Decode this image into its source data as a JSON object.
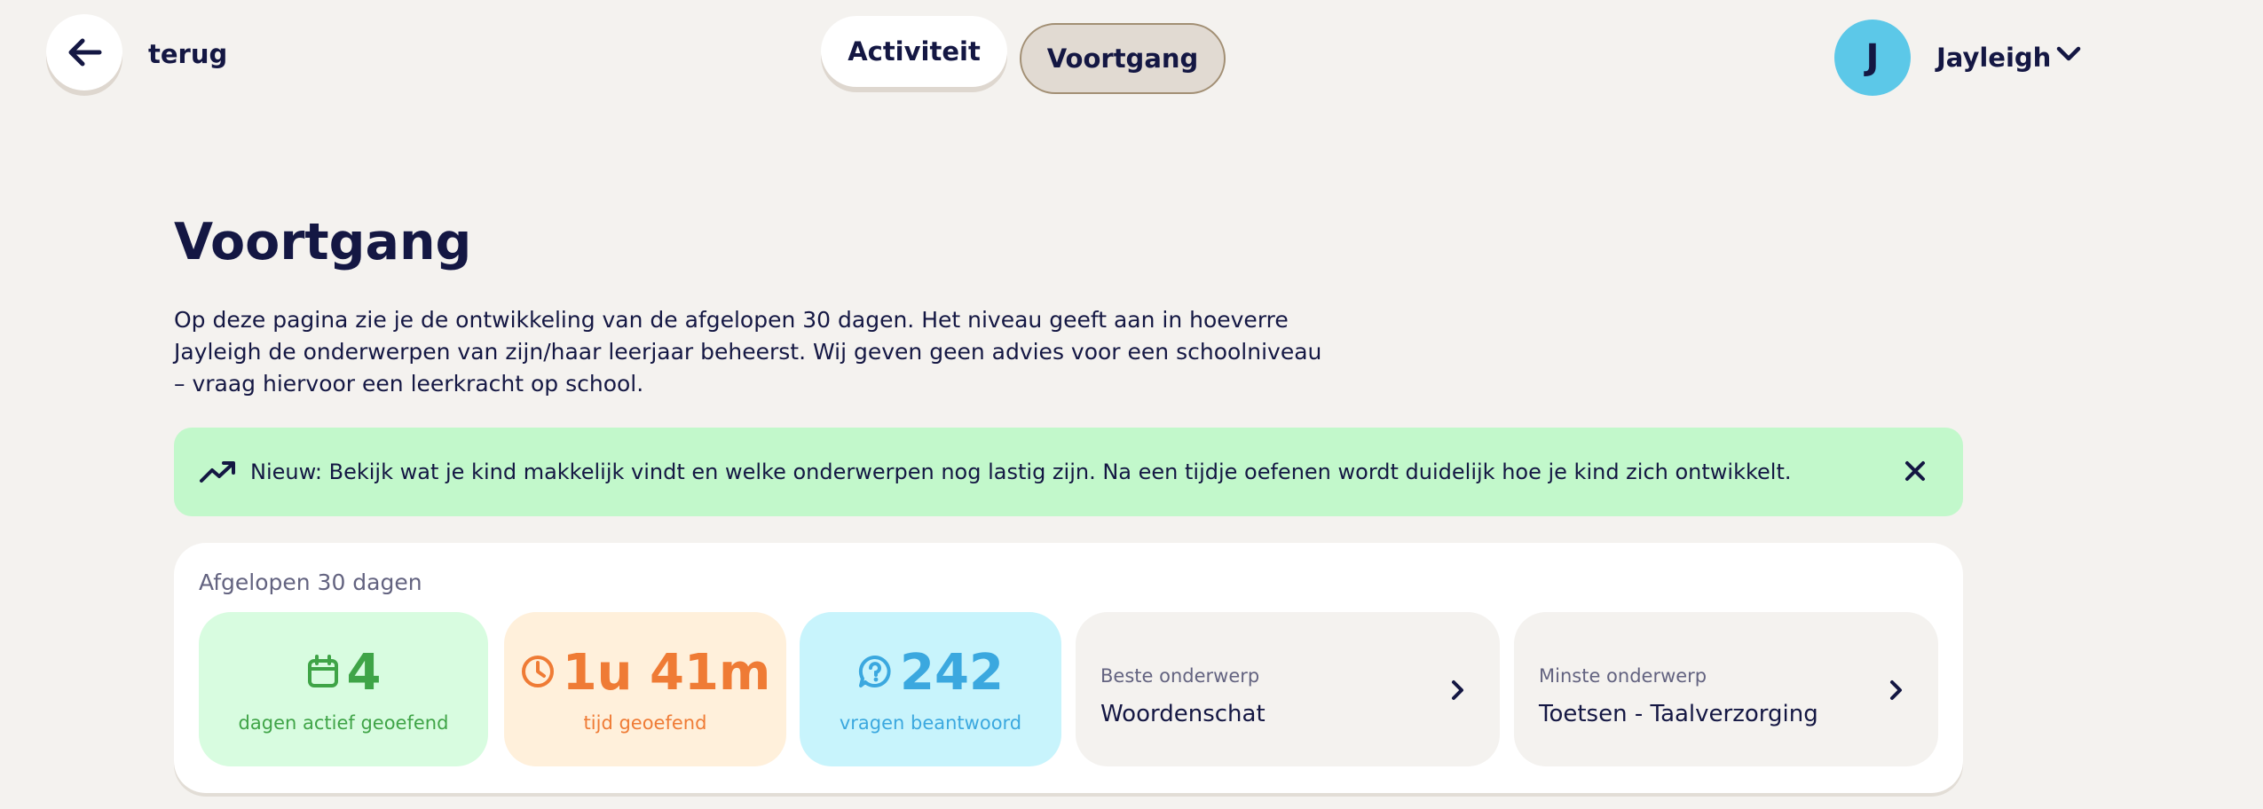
{
  "header": {
    "back_label": "terug",
    "tabs": [
      {
        "label": "Activiteit",
        "active": false
      },
      {
        "label": "Voortgang",
        "active": true
      }
    ],
    "user": {
      "initial": "J",
      "name": "Jayleigh"
    }
  },
  "page": {
    "title": "Voortgang",
    "intro": "Op deze pagina zie je de ontwikkeling van de afgelopen 30 dagen. Het niveau geeft aan in hoeverre Jayleigh de onderwerpen van zijn/haar leerjaar beheerst. Wij geven geen advies voor een schoolniveau – vraag hiervoor een leerkracht op school."
  },
  "banner": {
    "text": "Nieuw: Bekijk wat je kind makkelijk vindt en welke onderwerpen nog lastig zijn. Na een tijdje oefenen wordt duidelijk hoe je kind zich ontwikkelt.",
    "icon": "trending-up-icon",
    "color": "#c2f8cb"
  },
  "stats": {
    "period_label": "Afgelopen 30 dagen",
    "days": {
      "value": "4",
      "caption": "dagen actief geoefend",
      "icon": "calendar-icon",
      "color": "#3fa447"
    },
    "time": {
      "value": "1u 41m",
      "caption": "tijd geoefend",
      "icon": "clock-icon",
      "color": "#ef7b35"
    },
    "questions": {
      "value": "242",
      "caption": "vragen beantwoord",
      "icon": "question-bubble-icon",
      "color": "#3ba8df"
    },
    "best_topic": {
      "label": "Beste onderwerp",
      "value": "Woordenschat"
    },
    "least_topic": {
      "label": "Minste onderwerp",
      "value": "Toetsen - Taalverzorging"
    }
  }
}
